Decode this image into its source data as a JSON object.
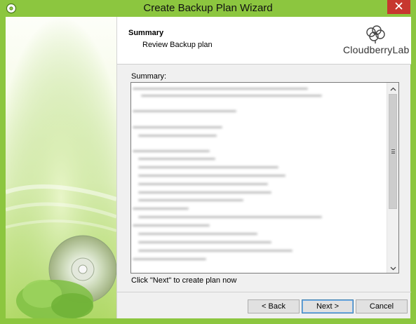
{
  "window": {
    "title": "Create Backup Plan Wizard",
    "close_icon": "close-icon",
    "app_icon": "cloudberry-app-icon",
    "accent_color": "#8cc63f",
    "close_color": "#c7372f"
  },
  "header": {
    "title": "Summary",
    "subtitle": "Review Backup plan",
    "logo_text": "CloudberryLab"
  },
  "summary": {
    "label": "Summary:",
    "content_state": "blurred"
  },
  "hint": "Click \"Next\" to create plan now",
  "buttons": {
    "back": "< Back",
    "next": "Next >",
    "cancel": "Cancel"
  }
}
